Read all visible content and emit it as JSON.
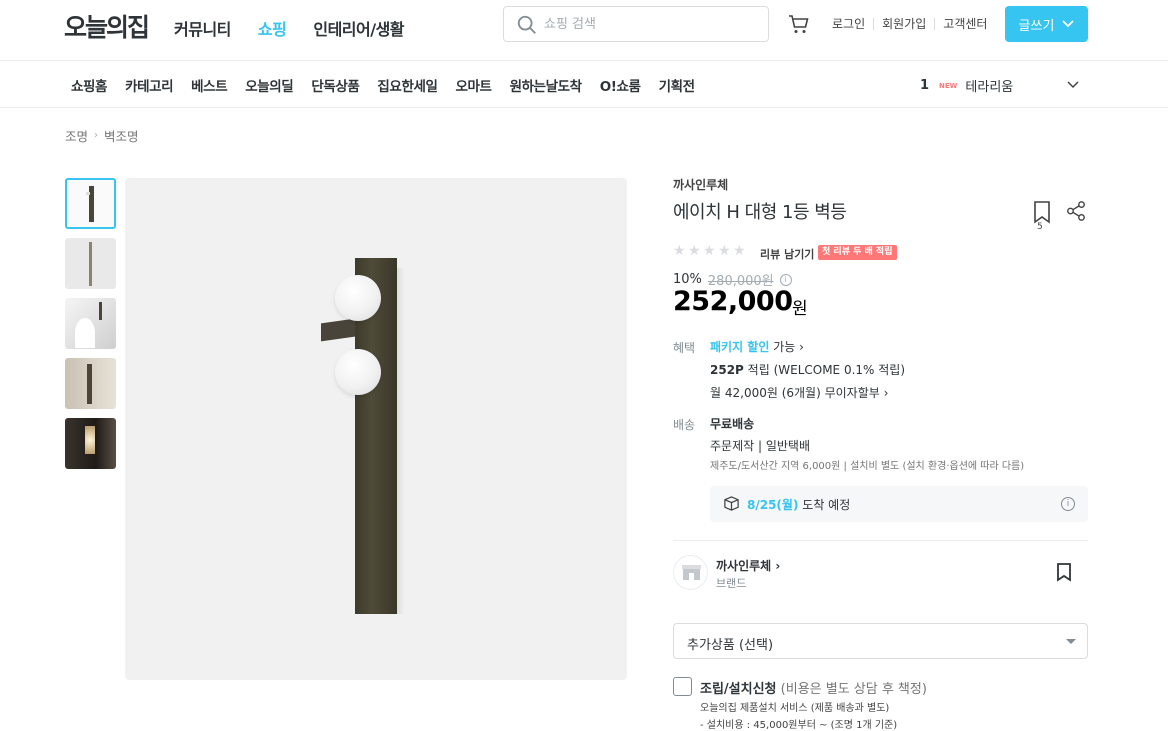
{
  "header": {
    "logo": "오늘의집",
    "nav": [
      "커뮤니티",
      "쇼핑",
      "인테리어/생활"
    ],
    "active_nav": "쇼핑",
    "search_placeholder": "쇼핑 검색",
    "login": "로그인",
    "signup": "회원가입",
    "support": "고객센터",
    "write_button": "글쓰기",
    "accent_color": "#35c5f0"
  },
  "subnav": {
    "items": [
      "쇼핑홈",
      "카테고리",
      "베스트",
      "오늘의딜",
      "단독상품",
      "집요한세일",
      "오마트",
      "원하는날도착",
      "O!쇼룸",
      "기획전"
    ],
    "ranking_number": "1",
    "ranking_badge": "NEW",
    "ranking_keyword": "테라리움"
  },
  "breadcrumb": [
    "조명",
    "벽조명"
  ],
  "product": {
    "brand": "까사인루체",
    "title": "에이치 H 대형 1등 벽등",
    "bookmark_count": "5",
    "review_link": "리뷰 남기기",
    "review_badge": "첫 리뷰 두 배 적립",
    "discount": "10%",
    "original_price": "280,000원",
    "price": "252,000",
    "currency": "원"
  },
  "benefits": {
    "label": "혜택",
    "package_link": "패키지 할인",
    "package_suffix": "가능 ›",
    "points": "252P",
    "points_suffix": "적립 (WELCOME 0.1% 적립)",
    "installment": "월 42,000원 (6개월) 무이자할부 ›"
  },
  "shipping": {
    "label": "배송",
    "type": "무료배송",
    "method": "주문제작 | 일반택배",
    "note": "제주도/도서산간 지역 6,000원 | 설치비 별도 (설치 환경·옵션에 따라 다름)",
    "arrival_date": "8/25(월)",
    "arrival_suffix": "도착 예정"
  },
  "brand_card": {
    "name": "까사인루체 ›",
    "sub": "브랜드"
  },
  "options": {
    "select_label": "추가상품 (선택)",
    "install_title": "조립/설치신청",
    "install_note": "(비용은 별도 상담 후 책정)",
    "install_desc1": "오늘의집 제품설치 서비스 (제품 배송과 별도)",
    "install_desc2": "- 설치비용 : 45,000원부터 ~ (조명 1개 기준)"
  }
}
